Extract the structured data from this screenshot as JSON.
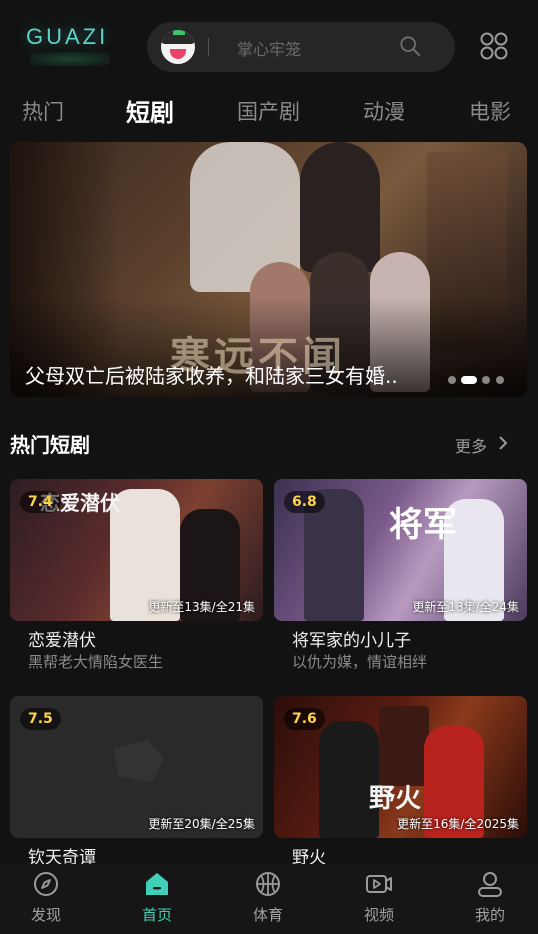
{
  "header": {
    "logo": "GUAZI",
    "search_placeholder": "掌心牢笼"
  },
  "tabs": [
    {
      "label": "热门",
      "active": false
    },
    {
      "label": "短剧",
      "active": true
    },
    {
      "label": "国产剧",
      "active": false
    },
    {
      "label": "动漫",
      "active": false
    },
    {
      "label": "电影",
      "active": false
    }
  ],
  "banner": {
    "title": "父母双亡后被陆家收养，和陆家三女有婚..",
    "poster_text": "寒远不闻",
    "dots": 4,
    "active_dot": 1
  },
  "section": {
    "title": "热门短剧",
    "more_label": "更多"
  },
  "cards": [
    {
      "score": "7.4",
      "episodes": "更新至13集/全21集",
      "title": "恋爱潜伏",
      "subtitle": "黑帮老大情陷女医生",
      "poster_text": "恋爱潜伏"
    },
    {
      "score": "6.8",
      "episodes": "更新至13集/全24集",
      "title": "将军家的小儿子",
      "subtitle": "以仇为媒，情谊相绊",
      "poster_text": "将军"
    },
    {
      "score": "7.5",
      "episodes": "更新至20集/全25集",
      "title": "钦天奇谭",
      "subtitle": ""
    },
    {
      "score": "7.6",
      "episodes": "更新至16集/全2025集",
      "title": "野火",
      "subtitle": "",
      "poster_text": "野火"
    }
  ],
  "nav": [
    {
      "label": "发现",
      "icon": "compass-icon",
      "active": false
    },
    {
      "label": "首页",
      "icon": "home-icon",
      "active": true
    },
    {
      "label": "体育",
      "icon": "basketball-icon",
      "active": false
    },
    {
      "label": "视频",
      "icon": "video-icon",
      "active": false
    },
    {
      "label": "我的",
      "icon": "user-icon",
      "active": false
    }
  ],
  "colors": {
    "accent": "#3fd1b8",
    "background": "#121212",
    "score": "#ffd448"
  }
}
